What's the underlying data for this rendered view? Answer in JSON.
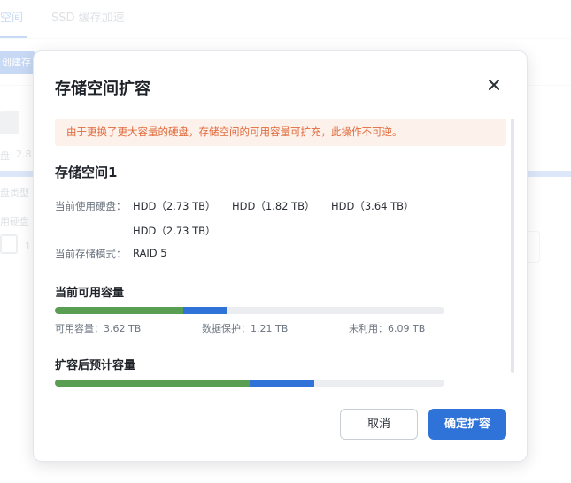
{
  "background": {
    "tabs": [
      "空间",
      "SSD 缓存加速"
    ],
    "create_button": "创建存",
    "disk_label": "盘",
    "disk_value": "2.8",
    "disk_type_label": "盘类型",
    "used_disk_label": "用硬盘",
    "used_disk_value": "1."
  },
  "dialog": {
    "title": "存储空间扩容",
    "close_icon": "close-icon",
    "warning": "由于更换了更大容量的硬盘，存储空间的可用容量可扩充，此操作不可逆。",
    "pool_name": "存储空间1",
    "current_disks_label": "当前使用硬盘：",
    "disks": [
      "HDD（2.73 TB）",
      "HDD（1.82 TB）",
      "HDD（3.64 TB）",
      "HDD（2.73 TB）"
    ],
    "mode_label": "当前存储模式：",
    "mode_value": "RAID 5",
    "current_capacity_title": "当前可用容量",
    "current_bar": {
      "available_pct": 33.0,
      "protection_pct": 11.2
    },
    "legend": {
      "available": "可用容量：3.62 TB",
      "protection": "数据保护：1.21 TB",
      "unused": "未利用：6.09 TB"
    },
    "expanded_capacity_title": "扩容后预计容量",
    "expanded_bar": {
      "available_pct": 50.0,
      "protection_pct": 16.6
    },
    "cancel_label": "取消",
    "confirm_label": "确定扩容",
    "colors": {
      "available": "#5a9e54",
      "protection": "#2f72d8",
      "unused": "#ebedf0",
      "warning": "#e06a3a"
    }
  }
}
